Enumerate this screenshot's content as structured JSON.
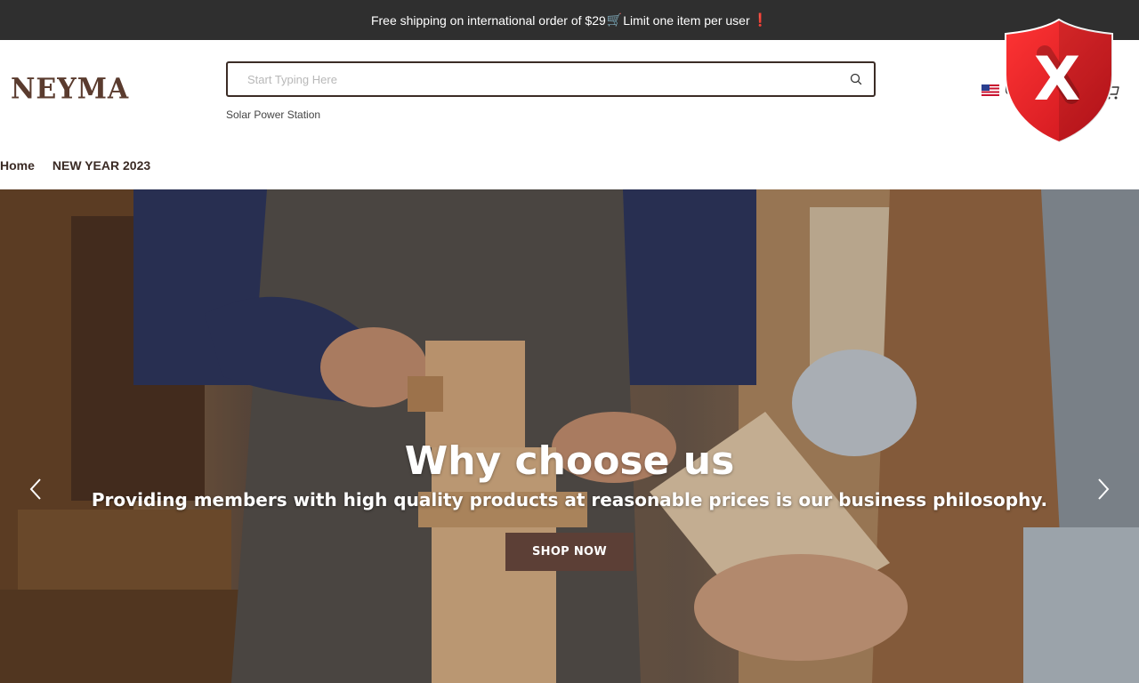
{
  "announcement": {
    "text": "Free shipping on international order of $29",
    "cart_emoji": "🛒",
    "text_after": "Limit one item per user",
    "exclamation": "❗"
  },
  "header": {
    "logo_text": "NEYMA",
    "search": {
      "placeholder": "Start Typing Here",
      "value": "",
      "icon": "search-icon"
    },
    "hot_search": "Solar Power Station",
    "locale": {
      "flag": "us-flag",
      "label": "U"
    },
    "cart_icon": "cart-icon"
  },
  "nav": {
    "items": [
      "Home",
      "NEW YEAR 2023"
    ]
  },
  "security_badge": {
    "icon": "shield-x-icon",
    "glyph": "X",
    "color": "#e41e26"
  },
  "hero": {
    "title": "Why choose us",
    "subtitle": "Providing members with high quality products at reasonable prices is our business philosophy.",
    "cta_label": "SHOP NOW",
    "prev_icon": "chevron-left-icon",
    "next_icon": "chevron-right-icon",
    "cta_color": "#5c3f36"
  },
  "colors": {
    "announcement_bg": "#2f2f2f",
    "brand": "#5a3b2e",
    "search_border": "#3b2c26"
  }
}
